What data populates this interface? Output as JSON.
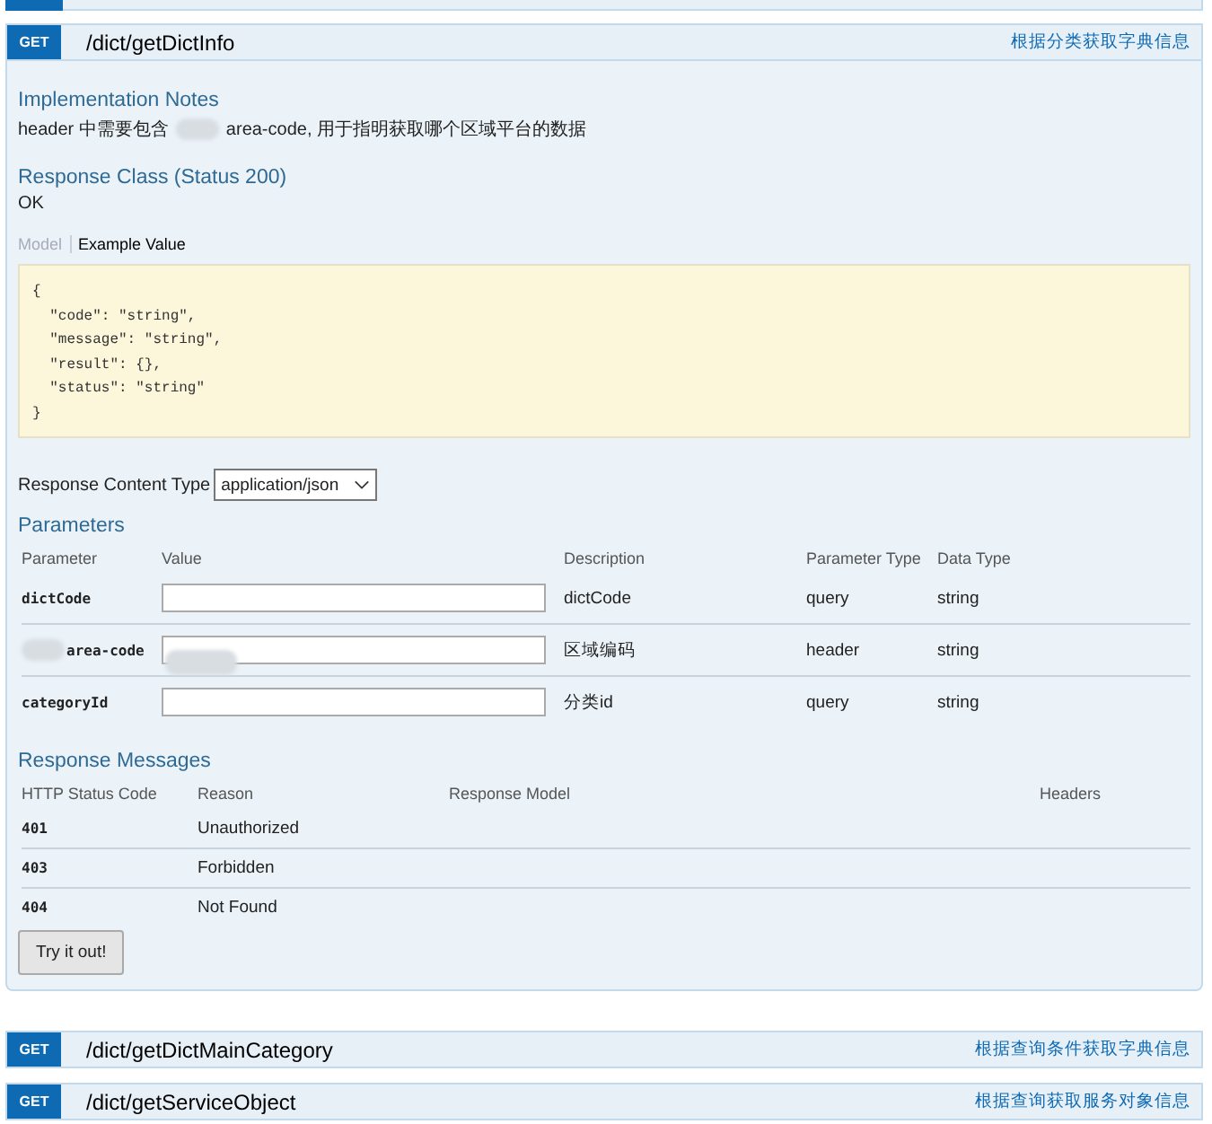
{
  "operations": [
    {
      "method": "GET",
      "path": "/dict/getDictInfo",
      "summary": "根据分类获取字典信息",
      "details": {
        "implementation_notes": {
          "title": "Implementation Notes",
          "before": "header 中需要包含",
          "after": "area-code, 用于指明获取哪个区域平台的数据"
        },
        "response_class": {
          "title": "Response Class (Status 200)",
          "text": "OK"
        },
        "model_tabs": [
          {
            "label": "Model",
            "selected": false
          },
          {
            "label": "Example Value",
            "selected": true
          }
        ],
        "example_lines": [
          "{",
          "  \"code\": \"string\",",
          "  \"message\": \"string\",",
          "  \"result\": {},",
          "  \"status\": \"string\"",
          "}"
        ],
        "content_type": {
          "label": "Response Content Type",
          "value": "application/json"
        },
        "parameters": {
          "title": "Parameters",
          "columns": [
            "Parameter",
            "Value",
            "Description",
            "Parameter Type",
            "Data Type"
          ],
          "rows": [
            {
              "name": "dictCode",
              "redacted": false,
              "description": "dictCode",
              "param_type": "query",
              "data_type": "string"
            },
            {
              "name": "area-code",
              "redacted": true,
              "description": "区域编码",
              "param_type": "header",
              "data_type": "string"
            },
            {
              "name": "categoryId",
              "redacted": false,
              "description": "分类id",
              "param_type": "query",
              "data_type": "string"
            }
          ]
        },
        "messages": {
          "title": "Response Messages",
          "columns": [
            "HTTP Status Code",
            "Reason",
            "Response Model",
            "Headers"
          ],
          "rows": [
            {
              "code": "401",
              "reason": "Unauthorized"
            },
            {
              "code": "403",
              "reason": "Forbidden"
            },
            {
              "code": "404",
              "reason": "Not Found"
            }
          ]
        },
        "try_button": "Try it out!"
      }
    },
    {
      "method": "GET",
      "path": "/dict/getDictMainCategory",
      "summary": "根据查询条件获取字典信息"
    },
    {
      "method": "GET",
      "path": "/dict/getServiceObject",
      "summary": "根据查询获取服务对象信息"
    }
  ]
}
